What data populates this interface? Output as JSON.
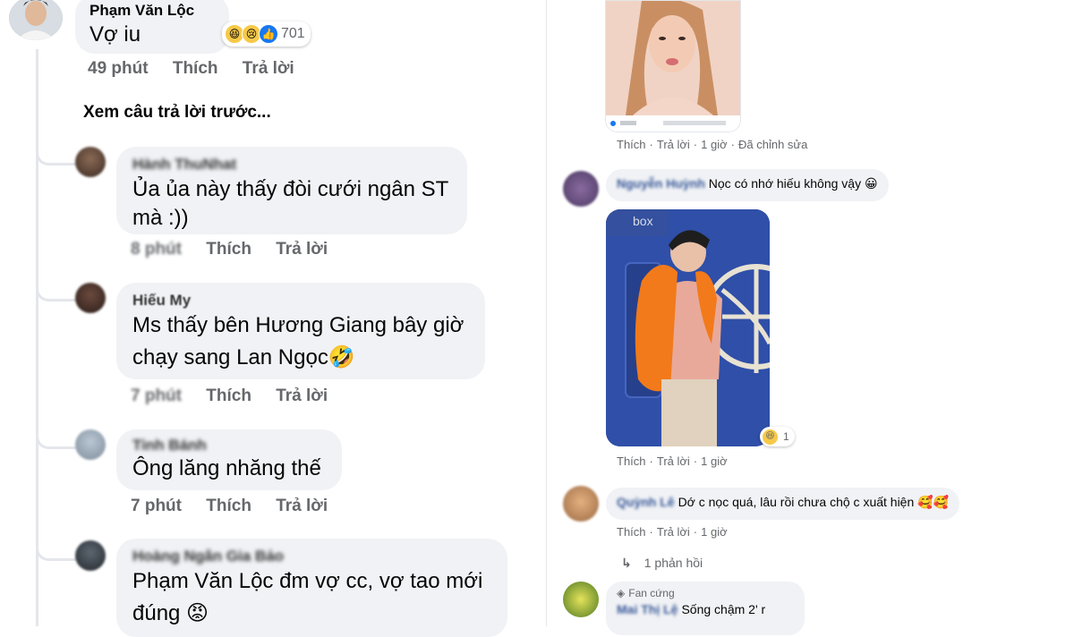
{
  "left": {
    "top_comment": {
      "author": "Phạm Văn Lộc",
      "text": "Vợ iu",
      "reaction_count": "701",
      "time": "49 phút",
      "like": "Thích",
      "reply": "Trả lời"
    },
    "see_previous": "Xem câu trả lời trước...",
    "replies": [
      {
        "author": "Hành ThuNhat",
        "line1": "Ủa ủa này thấy đòi cưới ngân ST",
        "line2": "mà :))",
        "time": "8 phút",
        "like": "Thích",
        "reply": "Trả lời"
      },
      {
        "author": "Hiếu My",
        "line1": "Ms thấy bên Hương Giang bây giờ",
        "line2": "chạy sang Lan Ngọc🤣",
        "time": "7 phút",
        "like": "Thích",
        "reply": "Trả lời"
      },
      {
        "author": "Tinh Bánh",
        "line1": "Ông lăng nhăng thế",
        "time": "7 phút",
        "like": "Thích",
        "reply": "Trả lời"
      },
      {
        "author": "Hoàng Ngân Gia Bảo",
        "line1": "Phạm Văn Lộc đm vợ cc, vợ tao mới",
        "line2": "đúng 😡"
      }
    ]
  },
  "right": {
    "c1": {
      "like": "Thích",
      "reply": "Trả lời",
      "time": "1 giờ",
      "edited": "Đã chỉnh sửa"
    },
    "c2": {
      "author": "Nguyễn Huỳnh",
      "text": "Nọc có nhớ hiếu không vậy 😀",
      "photo_label": "box",
      "reaction_count": "1",
      "like": "Thích",
      "reply": "Trả lời",
      "time": "1 giờ"
    },
    "c3": {
      "author": "Quỳnh Lê",
      "text": "Dớ c nọc quá, lâu rồi chưa chộ c xuất hiện 🥰🥰",
      "like": "Thích",
      "reply": "Trả lời",
      "time": "1 giờ",
      "replies_link": "1 phản hồi"
    },
    "c4": {
      "badge": "Fan cứng",
      "author": "Mai Thị Lệ",
      "text": "Sống chậm 2' r"
    }
  },
  "colors": {
    "bubble_bg": "#f0f2f5",
    "meta_text": "#65676b",
    "like_blue": "#1877f2",
    "divider": "#e4e6eb",
    "reaction_yellow": "#f7c948"
  }
}
